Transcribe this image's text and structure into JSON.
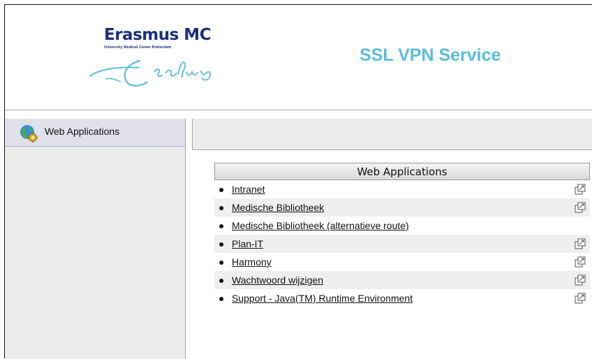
{
  "header": {
    "logo_title": "Erasmus MC",
    "logo_subtitle": "University Medical Center Rotterdam",
    "service_title": "SSL VPN Service"
  },
  "sidebar": {
    "items": [
      {
        "label": "Web Applications",
        "icon": "globe-gear-icon"
      }
    ]
  },
  "apps": {
    "header": "Web Applications",
    "rows": [
      {
        "label": "Intranet",
        "external": true
      },
      {
        "label": "Medische Bibliotheek",
        "external": true
      },
      {
        "label": "Medische Bibliotheek (alternatieve route)",
        "external": false
      },
      {
        "label": "Plan-IT",
        "external": true
      },
      {
        "label": "Harmony",
        "external": true
      },
      {
        "label": "Wachtwoord wijzigen",
        "external": true
      },
      {
        "label": "Support - Java(TM) Runtime Environment",
        "external": true
      }
    ]
  },
  "colors": {
    "brand_blue": "#1c2f7a",
    "title_cyan": "#5bbcdc",
    "sidebar_selected": "#dfe0ea"
  }
}
